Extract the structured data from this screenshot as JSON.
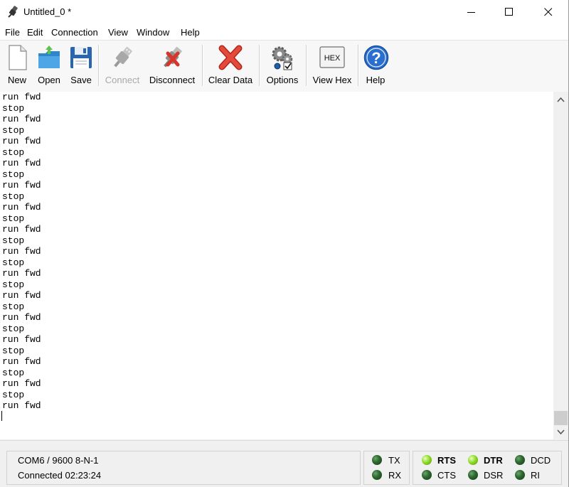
{
  "window": {
    "title": "Untitled_0 *"
  },
  "menu": {
    "items": [
      "File",
      "Edit",
      "Connection",
      "View",
      "Window",
      "Help"
    ]
  },
  "toolbar": {
    "new_label": "New",
    "open_label": "Open",
    "save_label": "Save",
    "connect_label": "Connect",
    "disconnect_label": "Disconnect",
    "clear_label": "Clear Data",
    "options_label": "Options",
    "viewhex_label": "View Hex",
    "viewhex_icon_text": "HEX",
    "help_label": "Help",
    "help_icon_text": "?",
    "connect_enabled": false
  },
  "terminal": {
    "lines": [
      "run fwd",
      "stop",
      "run fwd",
      "stop",
      "run fwd",
      "stop",
      "run fwd",
      "stop",
      "run fwd",
      "stop",
      "run fwd",
      "stop",
      "run fwd",
      "stop",
      "run fwd",
      "stop",
      "run fwd",
      "stop",
      "run fwd",
      "stop",
      "run fwd",
      "stop",
      "run fwd",
      "stop",
      "run fwd",
      "stop",
      "run fwd",
      "stop",
      "run fwd"
    ]
  },
  "status": {
    "port_info": "COM6 / 9600 8-N-1",
    "connection": "Connected 02:23:24"
  },
  "signals": {
    "tx": {
      "label": "TX",
      "on": false
    },
    "rx": {
      "label": "RX",
      "on": false
    },
    "rts": {
      "label": "RTS",
      "on": true
    },
    "cts": {
      "label": "CTS",
      "on": false
    },
    "dtr": {
      "label": "DTR",
      "on": true
    },
    "dsr": {
      "label": "DSR",
      "on": false
    },
    "dcd": {
      "label": "DCD",
      "on": false
    },
    "ri": {
      "label": "RI",
      "on": false
    }
  },
  "icons": {
    "app": "usb-plug-icon",
    "new": "new-document-icon",
    "open": "open-folder-icon",
    "save": "floppy-disk-icon",
    "connect": "usb-plug-icon",
    "disconnect": "usb-disconnect-icon",
    "clear": "red-x-icon",
    "options": "gears-icon",
    "viewhex": "hex-icon",
    "help": "question-icon"
  }
}
